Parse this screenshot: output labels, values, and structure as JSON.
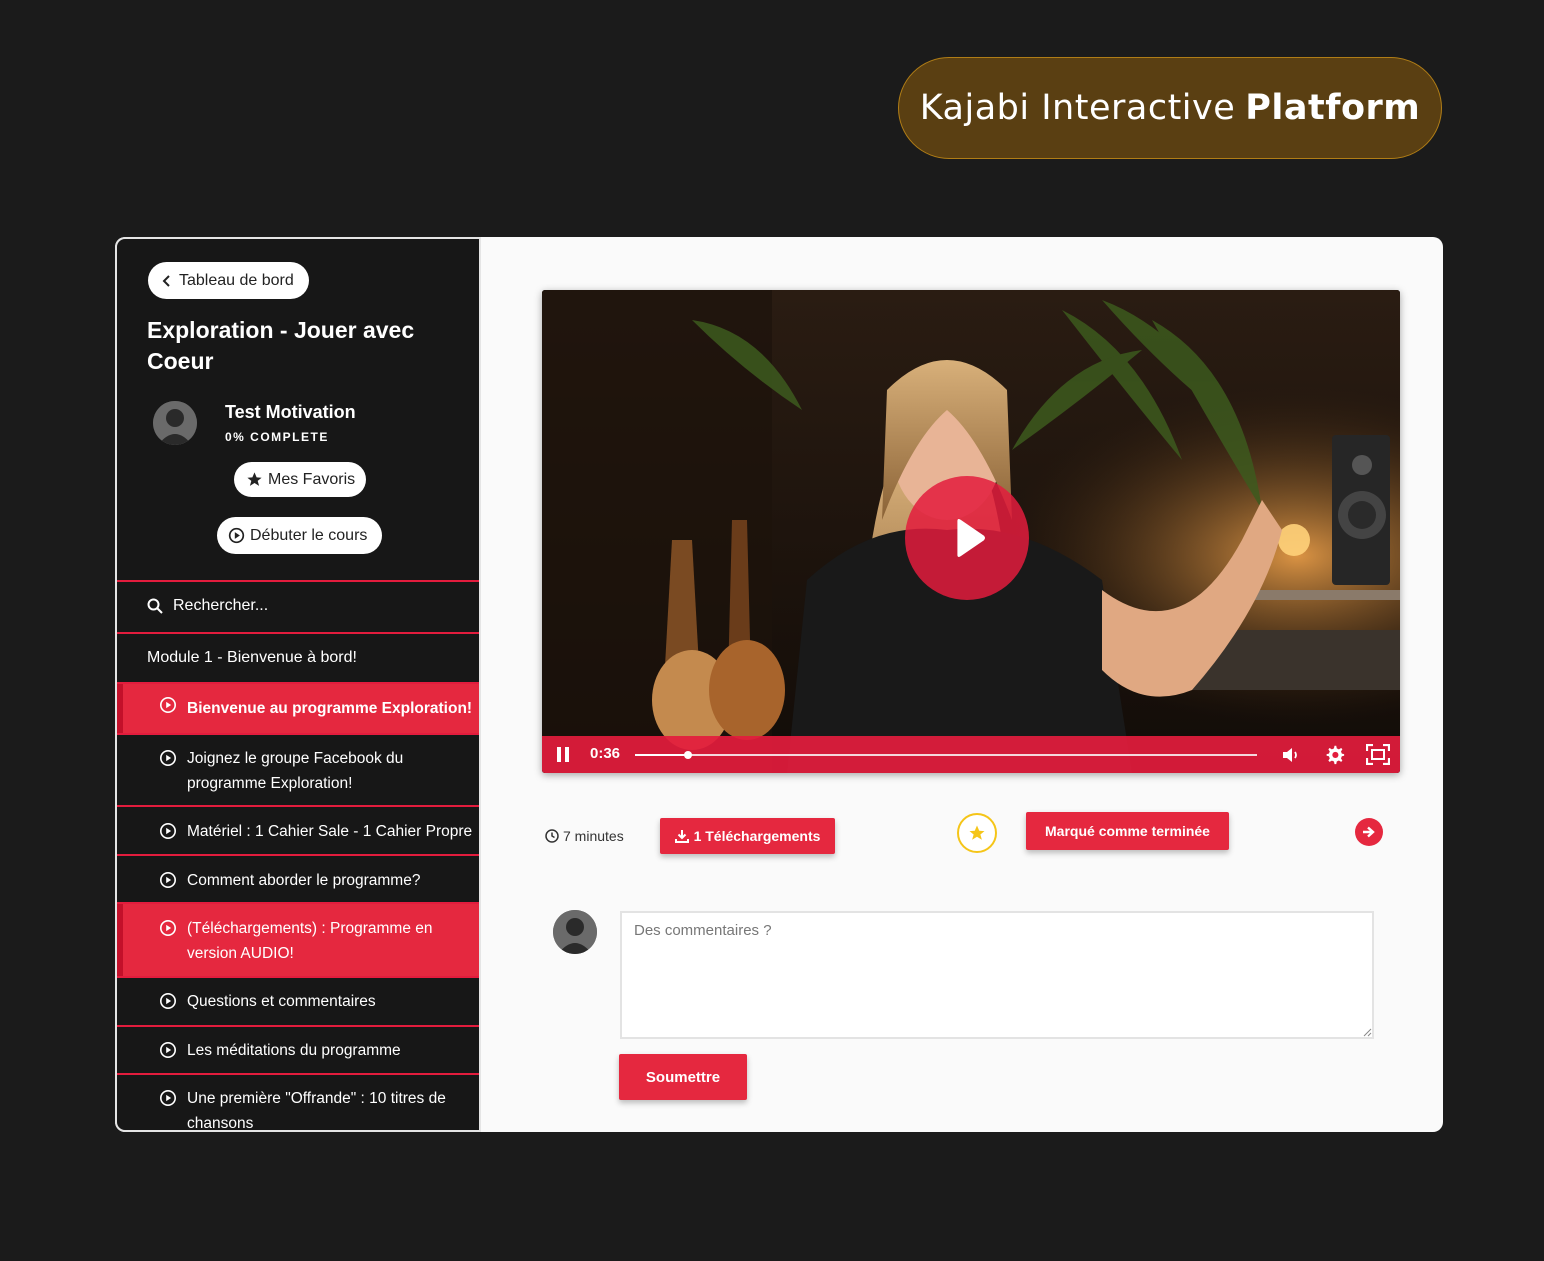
{
  "badge": {
    "light": "Kajabi Interactive",
    "bold": "Platform"
  },
  "sidebar": {
    "back_label": "Tableau de bord",
    "course_title": "Exploration - Jouer avec Coeur",
    "user_name": "Test Motivation",
    "progress_label": "0% COMPLETE",
    "favorites_label": "Mes Favoris",
    "start_label": "Débuter le cours",
    "search_placeholder": "Rechercher...",
    "module_title": "Module 1 - Bienvenue à bord!",
    "lessons": [
      {
        "title": "Bienvenue au programme Exploration!",
        "active": true,
        "bold": true
      },
      {
        "title": "Joignez le groupe Facebook du programme Exploration!",
        "active": false
      },
      {
        "title": "Matériel : 1 Cahier Sale - 1 Cahier Propre",
        "active": false
      },
      {
        "title": "Comment aborder le programme?",
        "active": false
      },
      {
        "title": "(Téléchargements) : Programme en version AUDIO!",
        "active": true
      },
      {
        "title": "Questions et commentaires",
        "active": false
      },
      {
        "title": "Les méditations du programme",
        "active": false
      },
      {
        "title": "Une première \"Offrande\" : 10 titres de chansons",
        "active": false
      }
    ]
  },
  "video": {
    "time": "0:36",
    "progress": 0.085
  },
  "meta": {
    "duration": "7 minutes",
    "downloads_label": "1 Téléchargements",
    "complete_label": "Marqué comme terminée"
  },
  "comments": {
    "placeholder": "Des commentaires ?",
    "submit_label": "Soumettre"
  },
  "colors": {
    "accent": "#e5283f",
    "sidebar_bg": "#171717",
    "badge_bg": "#5a3f12",
    "star": "#f5c518"
  }
}
